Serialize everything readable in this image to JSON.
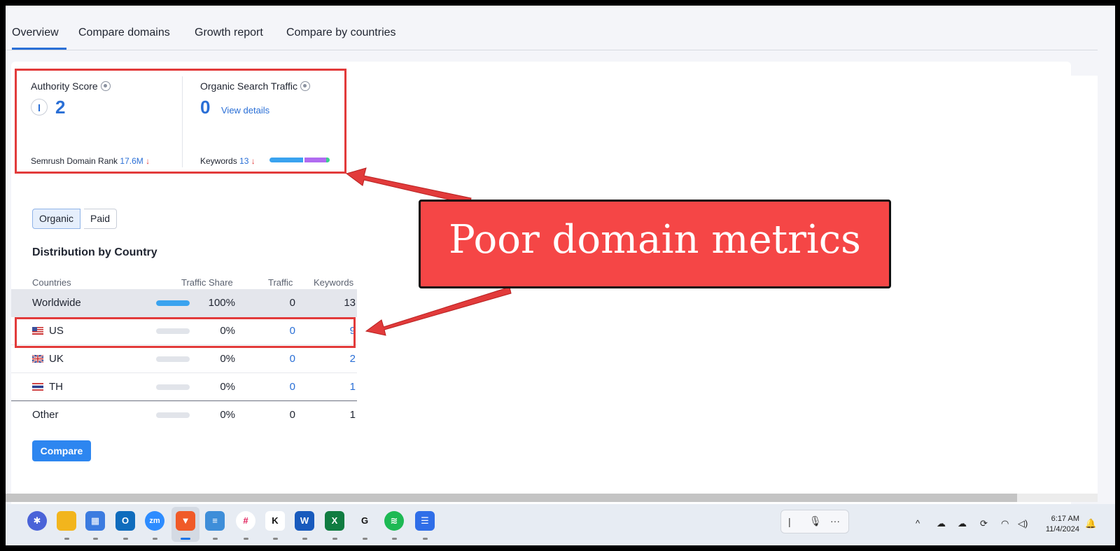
{
  "tabs": {
    "overview": "Overview",
    "compare_domains": "Compare domains",
    "growth_report": "Growth report",
    "compare_by_countries": "Compare by countries"
  },
  "metrics": {
    "authority_label": "Authority Score",
    "authority_value": "2",
    "organic_label": "Organic Search Traffic",
    "organic_value": "0",
    "view_details": "View details",
    "rank_label": "Semrush Domain Rank",
    "rank_value": "17.6M",
    "keywords_label": "Keywords",
    "keywords_value": "13",
    "down_arrow": "↓"
  },
  "distribution": {
    "toggle_organic": "Organic",
    "toggle_paid": "Paid",
    "title": "Distribution by Country",
    "headers": {
      "countries": "Countries",
      "traffic_share": "Traffic Share",
      "traffic": "Traffic",
      "keywords": "Keywords"
    },
    "rows": [
      {
        "country": "Worldwide",
        "share": "100%",
        "share_fraction": 1.0,
        "traffic": "0",
        "keywords": "13"
      },
      {
        "country": "US",
        "share": "0%",
        "share_fraction": 0,
        "traffic": "0",
        "keywords": "9"
      },
      {
        "country": "UK",
        "share": "0%",
        "share_fraction": 0,
        "traffic": "0",
        "keywords": "2"
      },
      {
        "country": "TH",
        "share": "0%",
        "share_fraction": 0,
        "traffic": "0",
        "keywords": "1"
      },
      {
        "country": "Other",
        "share": "0%",
        "share_fraction": 0,
        "traffic": "0",
        "keywords": "1"
      }
    ],
    "compare_button": "Compare"
  },
  "callout": {
    "text": "Poor domain metrics",
    "color": "#f54646"
  },
  "taskbar": {
    "time": "6:17 AM",
    "date": "11/4/2024",
    "voice_more": "···"
  },
  "colors": {
    "accent": "#2a6fd6",
    "highlight_border": "#e23b3b",
    "button": "#2d86f0"
  }
}
